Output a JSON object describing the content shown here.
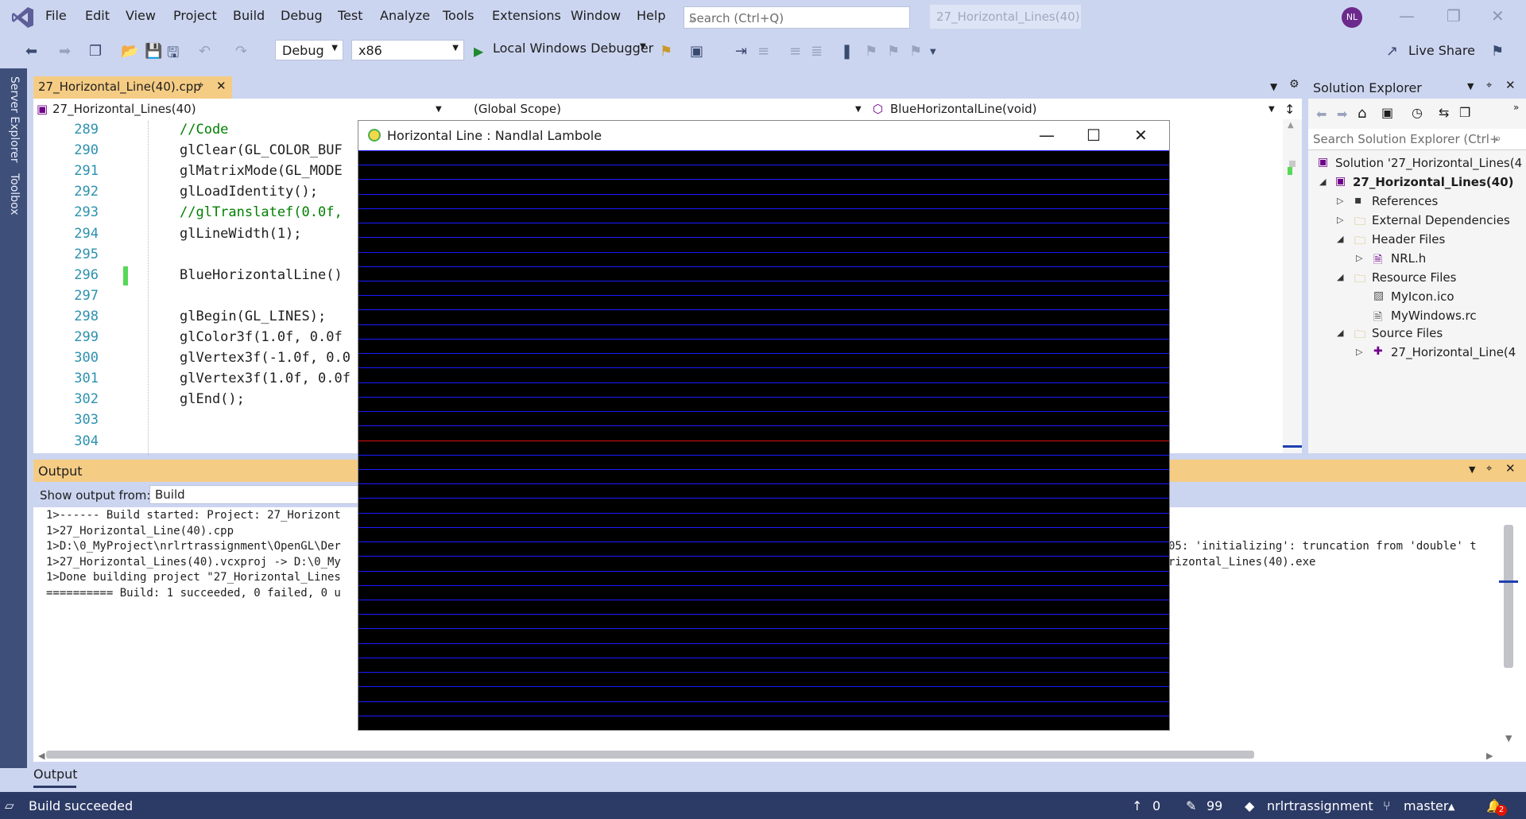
{
  "menu": [
    "File",
    "Edit",
    "View",
    "Project",
    "Build",
    "Debug",
    "Test",
    "Analyze",
    "Tools",
    "Extensions",
    "Window",
    "Help"
  ],
  "search": {
    "placeholder": "Search (Ctrl+Q)"
  },
  "solution_title": "27_Horizontal_Lines(40)",
  "avatar": "NL",
  "toolbar": {
    "config": "Debug",
    "platform": "x86",
    "debugger": "Local Windows Debugger",
    "live_share": "Live Share"
  },
  "left_rail": {
    "server_explorer": "Server Explorer",
    "toolbox": "Toolbox"
  },
  "editor": {
    "tab": "27_Horizontal_Line(40).cpp",
    "nav_project": "27_Horizontal_Lines(40)",
    "nav_scope": "(Global Scope)",
    "nav_member": "BlueHorizontalLine(void)",
    "lines": [
      {
        "n": "289",
        "code": "//Code",
        "kind": "comment"
      },
      {
        "n": "290",
        "code": "glClear(GL_COLOR_BUF",
        "kind": "code"
      },
      {
        "n": "291",
        "code": "glMatrixMode(GL_MODE",
        "kind": "code"
      },
      {
        "n": "292",
        "code": "glLoadIdentity();",
        "kind": "code"
      },
      {
        "n": "293",
        "code": "//glTranslatef(0.0f,",
        "kind": "comment"
      },
      {
        "n": "294",
        "code": "glLineWidth(1);",
        "kind": "code"
      },
      {
        "n": "295",
        "code": "",
        "kind": "code"
      },
      {
        "n": "296",
        "code": "BlueHorizontalLine()",
        "kind": "code"
      },
      {
        "n": "297",
        "code": "",
        "kind": "code"
      },
      {
        "n": "298",
        "code": "glBegin(GL_LINES);",
        "kind": "code"
      },
      {
        "n": "299",
        "code": "glColor3f(1.0f, 0.0f",
        "kind": "code"
      },
      {
        "n": "300",
        "code": "glVertex3f(-1.0f, 0.0",
        "kind": "code"
      },
      {
        "n": "301",
        "code": "glVertex3f(1.0f, 0.0f",
        "kind": "code"
      },
      {
        "n": "302",
        "code": "glEnd();",
        "kind": "code"
      },
      {
        "n": "303",
        "code": "",
        "kind": "code"
      },
      {
        "n": "304",
        "code": "",
        "kind": "code"
      }
    ]
  },
  "solution_explorer": {
    "title": "Solution Explorer",
    "search_placeholder": "Search Solution Explorer (Ctrl+",
    "solution": "Solution '27_Horizontal_Lines(4",
    "project": "27_Horizontal_Lines(40)",
    "items": [
      "References",
      "External Dependencies",
      "Header Files",
      "NRL.h",
      "Resource Files",
      "MyIcon.ico",
      "MyWindows.rc",
      "Source Files",
      "27_Horizontal_Line(4"
    ]
  },
  "output": {
    "title": "Output",
    "show_from_label": "Show output from:",
    "show_from_value": "Build",
    "lines_left": [
      "1>------ Build started: Project: 27_Horizont",
      "1>27_Horizontal_Line(40).cpp",
      "1>D:\\0_MyProject\\nrlrtrassignment\\OpenGL\\Der",
      "1>27_Horizontal_Lines(40).vcxproj -> D:\\0_My",
      "1>Done building project \"27_Horizontal_Lines",
      "========== Build: 1 succeeded, 0 failed, 0 u"
    ],
    "right_line_1": "05: 'initializing': truncation from 'double' t",
    "right_line_2": "rizontal_Lines(40).exe",
    "bottom_tab": "Output"
  },
  "gl_window": {
    "title": "Horizontal Line : Nandlal Lambole",
    "line_count": 40,
    "line_color": "#1a1aff",
    "center_color": "#e01010",
    "bg_color": "#000000"
  },
  "status": {
    "left": "Build succeeded",
    "push": "0",
    "edits": "99",
    "repo": "nrlrtrassignment",
    "branch": "master",
    "notifications": "2"
  },
  "colors": {
    "accent": "#f5cc84",
    "statusbar": "#2c3a66",
    "chrome": "#ccd5f0"
  }
}
